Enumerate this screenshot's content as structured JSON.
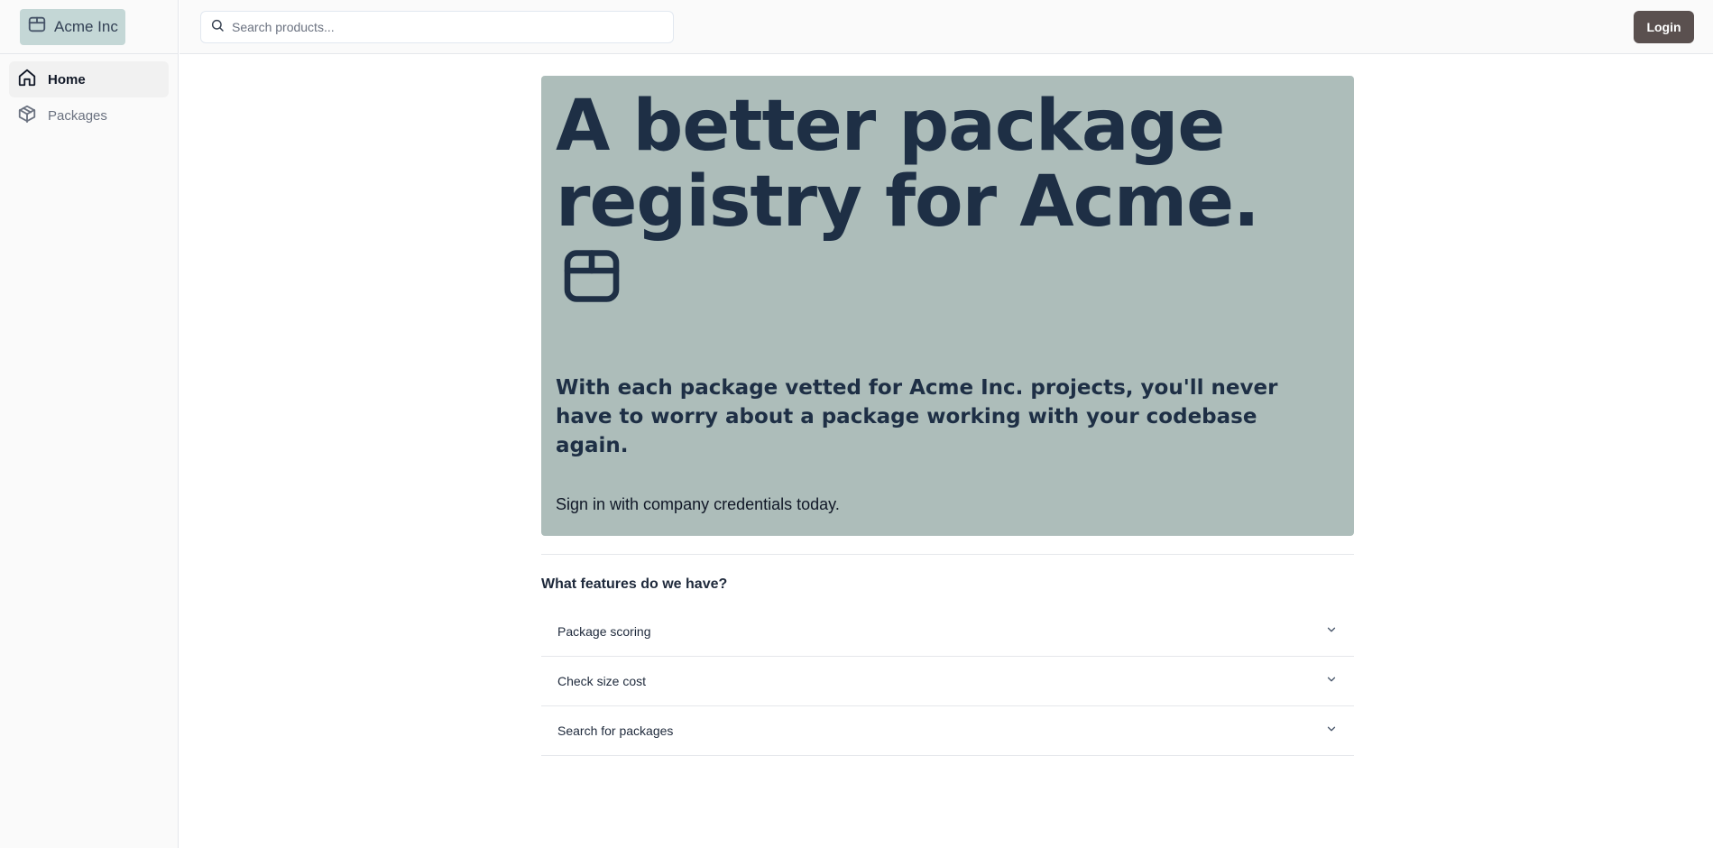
{
  "brand": {
    "name": "Acme Inc",
    "icon": "package-icon",
    "bg": "#c4d7d6"
  },
  "sidebar": {
    "items": [
      {
        "label": "Home",
        "icon": "home-icon",
        "active": true
      },
      {
        "label": "Packages",
        "icon": "cube-icon",
        "active": false
      }
    ]
  },
  "header": {
    "search_placeholder": "Search products...",
    "login_label": "Login"
  },
  "hero": {
    "title": "A better package registry for Acme.",
    "icon": "package-icon",
    "subtitle": "With each package vetted for Acme Inc. projects, you'll never have to worry about a package working with your codebase again.",
    "cta": "Sign in with company credentials today.",
    "bg": "#adbdba",
    "text_color": "#1e2f45"
  },
  "features": {
    "title": "What features do we have?",
    "items": [
      {
        "label": "Package scoring"
      },
      {
        "label": "Check size cost"
      },
      {
        "label": "Search for packages"
      }
    ]
  },
  "colors": {
    "login_bg": "#5a504f"
  }
}
